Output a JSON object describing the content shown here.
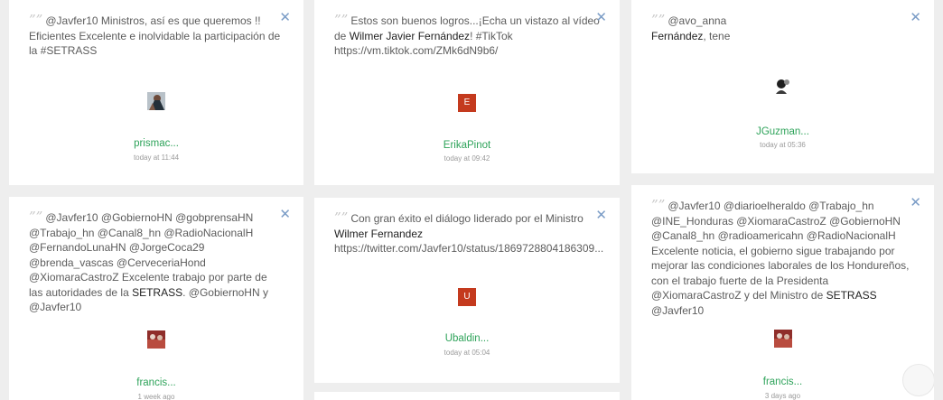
{
  "cards": [
    {
      "close": "✕",
      "quote": "””",
      "text_parts": [
        {
          "t": "@Javfer10 Ministros, así es que queremos !! Eficientes Excelente e inolvidable la participación de la ",
          "s": "plain"
        },
        {
          "t": "#SETRASS",
          "s": "plain"
        }
      ],
      "avatar_icon": "user-photo-icon",
      "user": "prismac...",
      "time": "today at 11:44"
    },
    {
      "close": "✕",
      "quote": "””",
      "text_parts": [
        {
          "t": "Estos son buenos logros...¡Echa un vistazo al vídeo de ",
          "s": "plain"
        },
        {
          "t": "Wilmer Javier Fernández",
          "s": "dark"
        },
        {
          "t": "! #TikTok https://vm.tiktok.com/ZMk6dN9b6/",
          "s": "plain"
        }
      ],
      "avatar_letter": "E",
      "user": "ErikaPinot",
      "time": "today at 09:42"
    },
    {
      "close": "✕",
      "quote": "””",
      "text_parts": [
        {
          "t": "@avo_anna ",
          "s": "plain"
        },
        {
          "t": "Fernández",
          "s": "dark"
        },
        {
          "t": ", tene",
          "s": "plain"
        }
      ],
      "avatar_icon": "user-photo-icon",
      "user": "JGuzman...",
      "time": "today at 05:36"
    },
    {
      "close": "✕",
      "quote": "””",
      "text_parts": [
        {
          "t": "@Javfer10 @GobiernoHN @gobprensaHN @Trabajo_hn @Canal8_hn @RadioNacionalH @FernandoLunaHN @JorgeCoca29 @brenda_vascas @CerveceriaHond @XiomaraCastroZ Excelente trabajo por parte de las autoridades de la ",
          "s": "plain"
        },
        {
          "t": "SETRASS",
          "s": "dark"
        },
        {
          "t": ". @GobiernoHN y @Javfer10",
          "s": "plain"
        }
      ],
      "avatar_icon": "user-photo-icon",
      "user": "francis...",
      "time": "1 week ago"
    },
    {
      "close": "✕",
      "quote": "””",
      "text_parts": [
        {
          "t": "Con gran éxito el diálogo liderado por el Ministro ",
          "s": "plain"
        },
        {
          "t": "Wilmer Fernandez",
          "s": "dark"
        },
        {
          "t": " https://twitter.com/Javfer10/status/1869728804186309...",
          "s": "plain"
        }
      ],
      "avatar_letter": "U",
      "user": "Ubaldin...",
      "time": "today at 05:04"
    },
    {
      "close": "✕",
      "quote": "””",
      "text_parts": [
        {
          "t": "@Javfer10 @diarioelheraldo @Trabajo_hn @INE_Honduras @XiomaraCastroZ @GobiernoHN @Canal8_hn @radioamericahn @RadioNacionalH Excelente noticia, el gobierno sigue trabajando por mejorar las condiciones laborales de los Hondureños, con el trabajo fuerte de la Presidenta @XiomaraCastroZ y del Ministro de ",
          "s": "plain"
        },
        {
          "t": "SETRASS",
          "s": "dark"
        },
        {
          "t": " @Javfer10",
          "s": "plain"
        }
      ],
      "avatar_icon": "user-photo-icon",
      "user": "francis...",
      "time": "3 days ago"
    }
  ],
  "colors": {
    "background": "#eeeeee",
    "card": "#ffffff",
    "link_green": "#2ea35a",
    "close_blue": "#7a9cc6",
    "avatar_red": "#c43a1e"
  }
}
